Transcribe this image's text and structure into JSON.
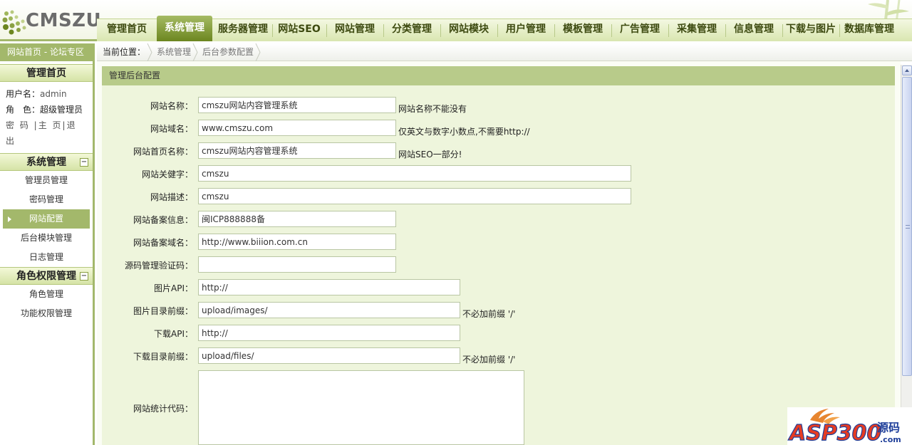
{
  "logo": {
    "text": "CMSZU"
  },
  "nav": {
    "items": [
      {
        "label": "管理首页",
        "active": false
      },
      {
        "label": "系统管理",
        "active": true
      },
      {
        "label": "服务器管理",
        "active": false
      },
      {
        "label": "网站SEO",
        "active": false
      },
      {
        "label": "网站管理",
        "active": false
      },
      {
        "label": "分类管理",
        "active": false
      },
      {
        "label": "网站模块",
        "active": false
      },
      {
        "label": "用户管理",
        "active": false
      },
      {
        "label": "模板管理",
        "active": false
      },
      {
        "label": "广告管理",
        "active": false
      },
      {
        "label": "采集管理",
        "active": false
      },
      {
        "label": "信息管理",
        "active": false
      },
      {
        "label": "下载与图片",
        "active": false
      },
      {
        "label": "数据库管理",
        "active": false
      }
    ]
  },
  "sidebar": {
    "top_links": "网站首页 - 论坛专区",
    "home_title": "管理首页",
    "user": {
      "username_label": "用户名：",
      "username_value": "admin",
      "role_label": "角　色：",
      "role_value": "超级管理员",
      "ops": [
        "密 码",
        "主 页",
        "退 出"
      ]
    },
    "groups": [
      {
        "title": "系统管理",
        "toggle": "−",
        "items": [
          {
            "label": "管理员管理",
            "active": false
          },
          {
            "label": "密码管理",
            "active": false
          },
          {
            "label": "网站配置",
            "active": true
          },
          {
            "label": "后台模块管理",
            "active": false
          },
          {
            "label": "日志管理",
            "active": false
          }
        ]
      },
      {
        "title": "角色权限管理",
        "toggle": "−",
        "items": [
          {
            "label": "角色管理",
            "active": false
          },
          {
            "label": "功能权限管理",
            "active": false
          }
        ]
      }
    ]
  },
  "breadcrumb": {
    "label": "当前位置：",
    "items": [
      "系统管理",
      "后台参数配置"
    ]
  },
  "panel": {
    "title": "管理后台配置",
    "fields": [
      {
        "label": "网站名称：",
        "value": "cmszu网站内容管理系统",
        "hint": "网站名称不能没有"
      },
      {
        "label": "网站域名：",
        "value": "www.cmszu.com",
        "hint": "仅英文与数字小数点,不需要http://"
      },
      {
        "label": "网站首页名称：",
        "value": "cmszu网站内容管理系统",
        "hint": "网站SEO一部分!"
      },
      {
        "label": "网站关健字：",
        "value": "cmszu",
        "hint": ""
      },
      {
        "label": "网站描述：",
        "value": "cmszu",
        "hint": ""
      },
      {
        "label": "网站备案信息：",
        "value": "闽ICP888888备",
        "hint": ""
      },
      {
        "label": "网站备案域名：",
        "value": "http://www.biiion.com.cn",
        "hint": ""
      },
      {
        "label": "源码管理验证码：",
        "value": "",
        "hint": ""
      },
      {
        "label": "图片API：",
        "value": "http://",
        "hint": ""
      },
      {
        "label": "图片目录前缀：",
        "value": "upload/images/",
        "hint": "不必加前缀 '/'"
      },
      {
        "label": "下载API：",
        "value": "http://",
        "hint": ""
      },
      {
        "label": "下载目录前缀：",
        "value": "upload/files/",
        "hint": "不必加前缀 '/'"
      },
      {
        "label": "网站统计代码：",
        "value": "",
        "hint": ""
      }
    ]
  },
  "watermark": {
    "main": "ASP300",
    "cn": "源码",
    "sub": ".com"
  },
  "colors": {
    "accent": "#a3b86b",
    "dark_accent": "#6c8620",
    "panel_title": "#b8cb8a",
    "form_bg": "#eef5dc"
  }
}
